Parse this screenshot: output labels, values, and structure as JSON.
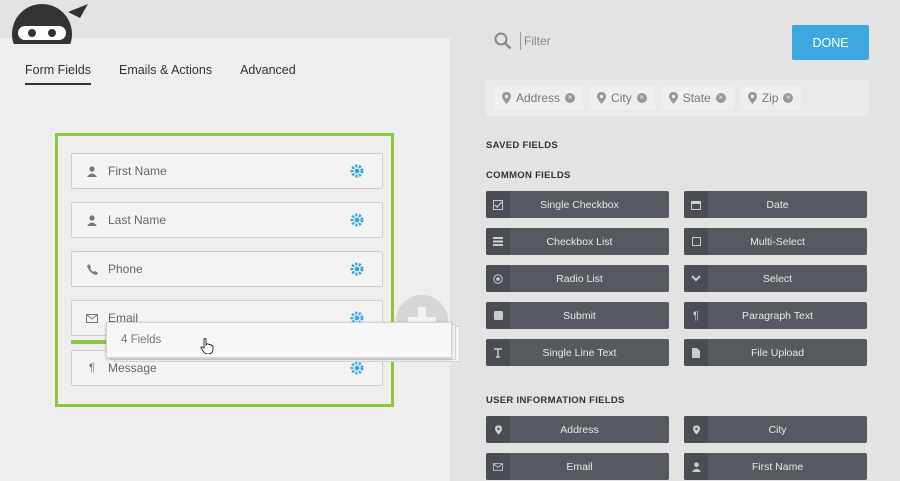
{
  "tabs": [
    {
      "label": "Form Fields",
      "active": true
    },
    {
      "label": "Emails & Actions",
      "active": false
    },
    {
      "label": "Advanced",
      "active": false
    }
  ],
  "form_fields": [
    {
      "label": "First Name",
      "icon": "user-icon"
    },
    {
      "label": "Last Name",
      "icon": "user-icon"
    },
    {
      "label": "Phone",
      "icon": "phone-icon"
    },
    {
      "label": "Email",
      "icon": "envelope-icon"
    },
    {
      "label": "Message",
      "icon": "paragraph-icon"
    }
  ],
  "drag_ghost": {
    "label": "4 Fields"
  },
  "filter": {
    "placeholder": "Filter"
  },
  "done_label": "DONE",
  "chips": [
    "Address",
    "City",
    "State",
    "Zip"
  ],
  "sections": {
    "saved": "SAVED FIELDS",
    "common": "COMMON FIELDS",
    "user_info": "USER INFORMATION FIELDS"
  },
  "common_fields": [
    {
      "label": "Single Checkbox",
      "icon": "checkbox-icon"
    },
    {
      "label": "Date",
      "icon": "calendar-icon"
    },
    {
      "label": "Checkbox List",
      "icon": "list-icon"
    },
    {
      "label": "Multi-Select",
      "icon": "square-icon"
    },
    {
      "label": "Radio List",
      "icon": "radio-icon"
    },
    {
      "label": "Select",
      "icon": "chevron-down-icon"
    },
    {
      "label": "Submit",
      "icon": "square-filled-icon"
    },
    {
      "label": "Paragraph Text",
      "icon": "paragraph-icon"
    },
    {
      "label": "Single Line Text",
      "icon": "text-icon"
    },
    {
      "label": "File Upload",
      "icon": "file-icon"
    }
  ],
  "user_fields": [
    {
      "label": "Address",
      "icon": "pin-icon"
    },
    {
      "label": "City",
      "icon": "pin-icon"
    },
    {
      "label": "Email",
      "icon": "envelope-icon"
    },
    {
      "label": "First Name",
      "icon": "user-icon"
    }
  ],
  "colors": {
    "accent": "#3da8df",
    "drop_border": "#8cc63f",
    "field_button": "#565a60"
  }
}
